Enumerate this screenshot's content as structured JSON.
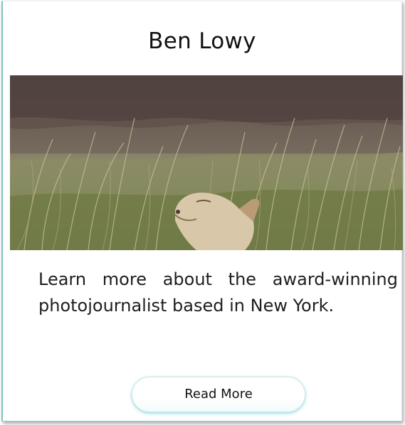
{
  "card": {
    "title": "Ben Lowy",
    "image_subject": "fox-in-tall-grass",
    "description": "Learn more about the award-winning photojournalist based in New York.",
    "button_label": "Read More"
  },
  "colors": {
    "accent_border": "#7fc4bf",
    "button_glow": "#64c8cd",
    "text": "#1e1e1e"
  }
}
